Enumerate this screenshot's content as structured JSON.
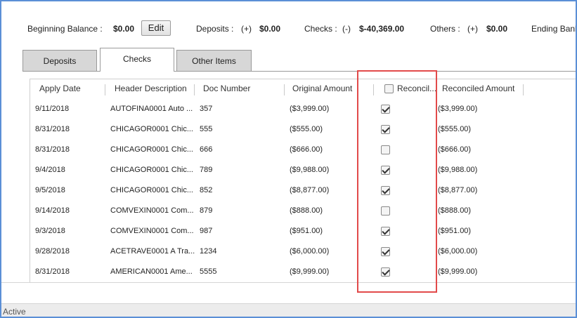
{
  "summary": {
    "beginning_label": "Beginning Balance :",
    "beginning_value": "$0.00",
    "edit_label": "Edit",
    "deposits_label": "Deposits :",
    "deposits_sign": "(+)",
    "deposits_value": "$0.00",
    "checks_label": "Checks :",
    "checks_sign": "(-)",
    "checks_value": "$-40,369.00",
    "others_label": "Others :",
    "others_sign": "(+)",
    "others_value": "$0.00",
    "ending_label": "Ending Bank"
  },
  "tabs": [
    "Deposits",
    "Checks",
    "Other Items"
  ],
  "active_tab": "Checks",
  "columns": {
    "apply_date": "Apply Date",
    "header_description": "Header Description",
    "doc_number": "Doc Number",
    "original_amount": "Original Amount",
    "reconciled": "Reconcil...",
    "reconciled_amount": "Reconciled Amount"
  },
  "rows": [
    {
      "date": "9/11/2018",
      "desc": "AUTOFINA0001 Auto ...",
      "doc": "357",
      "orig": "($3,999.00)",
      "reconciled": true,
      "rec_amt": "($3,999.00)"
    },
    {
      "date": "8/31/2018",
      "desc": "CHICAGOR0001 Chic...",
      "doc": "555",
      "orig": "($555.00)",
      "reconciled": true,
      "rec_amt": "($555.00)"
    },
    {
      "date": "8/31/2018",
      "desc": "CHICAGOR0001 Chic...",
      "doc": "666",
      "orig": "($666.00)",
      "reconciled": false,
      "rec_amt": "($666.00)"
    },
    {
      "date": "9/4/2018",
      "desc": "CHICAGOR0001 Chic...",
      "doc": "789",
      "orig": "($9,988.00)",
      "reconciled": true,
      "rec_amt": "($9,988.00)"
    },
    {
      "date": "9/5/2018",
      "desc": "CHICAGOR0001 Chic...",
      "doc": "852",
      "orig": "($8,877.00)",
      "reconciled": true,
      "rec_amt": "($8,877.00)"
    },
    {
      "date": "9/14/2018",
      "desc": "COMVEXIN0001 Com...",
      "doc": "879",
      "orig": "($888.00)",
      "reconciled": false,
      "rec_amt": "($888.00)"
    },
    {
      "date": "9/3/2018",
      "desc": "COMVEXIN0001 Com...",
      "doc": "987",
      "orig": "($951.00)",
      "reconciled": true,
      "rec_amt": "($951.00)"
    },
    {
      "date": "9/28/2018",
      "desc": "ACETRAVE0001 A Tra...",
      "doc": "1234",
      "orig": "($6,000.00)",
      "reconciled": true,
      "rec_amt": "($6,000.00)"
    },
    {
      "date": "8/31/2018",
      "desc": "AMERICAN0001 Ame...",
      "doc": "5555",
      "orig": "($9,999.00)",
      "reconciled": true,
      "rec_amt": "($9,999.00)"
    }
  ],
  "status": "Active",
  "colors": {
    "highlight": "#e24a4a",
    "frame": "#5b8fd6"
  }
}
